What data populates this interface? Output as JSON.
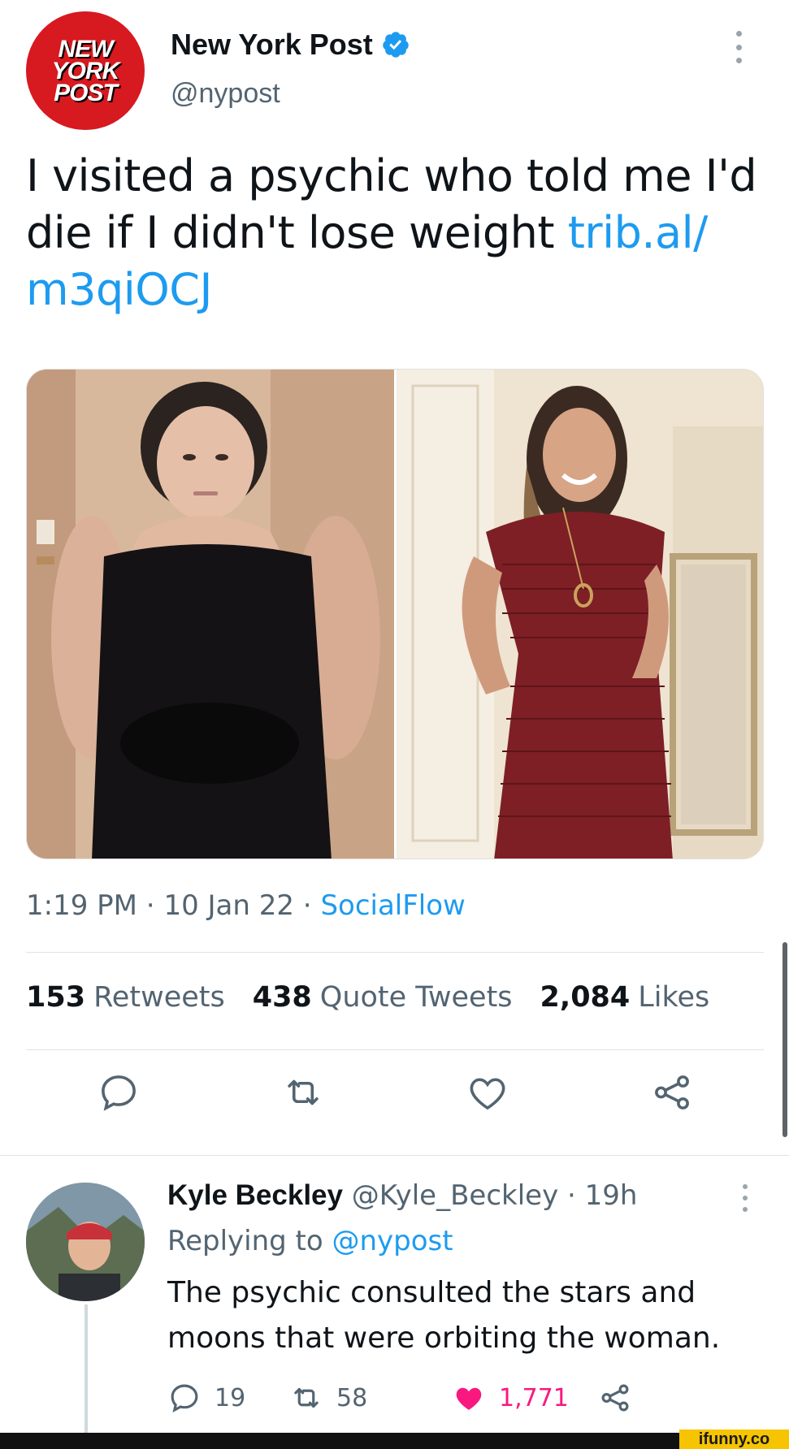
{
  "tweet": {
    "logo_lines": [
      "NEW",
      "YORK",
      "POST"
    ],
    "author_name": "New York Post",
    "handle": "@nypost",
    "text_part1": "I visited a psychic who told me I'd die if I didn't lose weight ",
    "text_link": "trib.al/​m3qiOCJ",
    "time": "1:19 PM",
    "date": "10 Jan 22",
    "source": "SocialFlow",
    "separator": " · "
  },
  "stats": {
    "retweets_count": "153",
    "retweets_label": "Retweets",
    "quotes_count": "438",
    "quotes_label": "Quote Tweets",
    "likes_count": "2,084",
    "likes_label": "Likes"
  },
  "reply": {
    "name": "Kyle Beckley",
    "handle_time": " @Kyle_Beckley · 19h",
    "replying_prefix": "Replying to ",
    "replying_mention": "@nypost",
    "text": "The psychic consulted the stars and moons that were orbiting the woman.",
    "replies": "19",
    "retweets": "58",
    "likes": "1,771"
  },
  "footer": {
    "watermark": "ifunny.co"
  },
  "colors": {
    "brand_red": "#d71920",
    "link_blue": "#1d9bf0",
    "like_pink": "#f91880",
    "muted": "#536471"
  },
  "icons": [
    "verified-badge-icon",
    "more-icon",
    "reply-icon",
    "retweet-icon",
    "like-icon",
    "share-icon"
  ]
}
